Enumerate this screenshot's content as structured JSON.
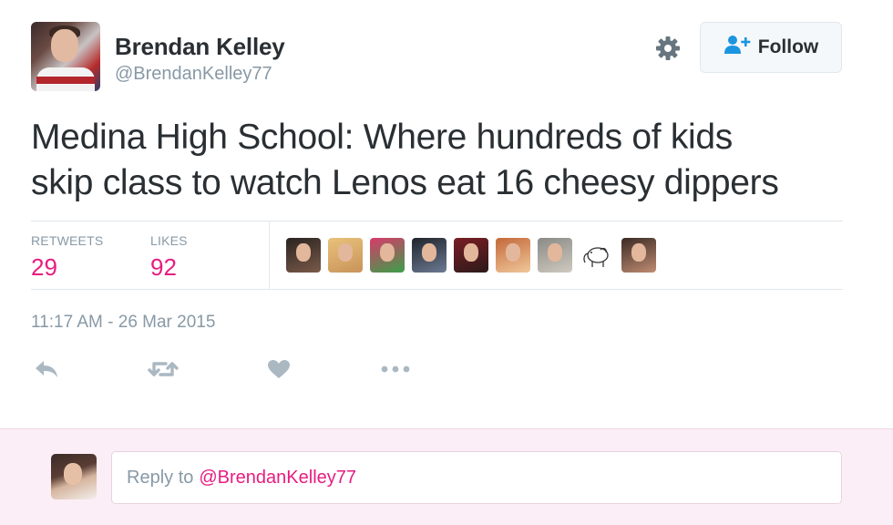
{
  "author": {
    "name": "Brendan Kelley",
    "handle": "@BrendanKelley77"
  },
  "follow_button": {
    "label": "Follow",
    "icon": "add-user-icon"
  },
  "settings_icon": "gear-icon",
  "tweet": {
    "line1": "Medina High School: Where hundreds of kids",
    "line2": "skip class to watch Lenos eat 16 cheesy dippers"
  },
  "stats": {
    "retweets_label": "RETWEETS",
    "retweets_value": "29",
    "likes_label": "LIKES",
    "likes_value": "92"
  },
  "likers": [
    {
      "name": "liker-avatar-1",
      "colors": [
        "#2a2320",
        "#7a5a4a"
      ]
    },
    {
      "name": "liker-avatar-2",
      "colors": [
        "#e8c27a",
        "#c9935a"
      ]
    },
    {
      "name": "liker-avatar-3",
      "colors": [
        "#d93a6a",
        "#3aa04a"
      ]
    },
    {
      "name": "liker-avatar-4",
      "colors": [
        "#20242c",
        "#6c7a92"
      ]
    },
    {
      "name": "liker-avatar-5",
      "colors": [
        "#7a1e24",
        "#2c1a1a"
      ]
    },
    {
      "name": "liker-avatar-6",
      "colors": [
        "#c4683a",
        "#f0c89a"
      ]
    },
    {
      "name": "liker-avatar-7",
      "colors": [
        "#8a8a86",
        "#cfcac0"
      ]
    },
    {
      "name": "liker-avatar-8",
      "colors": [
        "#ffffff",
        "#ffffff"
      ],
      "icon": "elephant-icon"
    },
    {
      "name": "liker-avatar-9",
      "colors": [
        "#3a2a24",
        "#c08c72"
      ]
    }
  ],
  "timestamp": "11:17 AM - 26 Mar 2015",
  "actions": [
    "reply-icon",
    "retweet-icon",
    "like-icon",
    "more-icon"
  ],
  "reply": {
    "prefix": "Reply to",
    "mention": "@BrendanKelley77"
  },
  "colors": {
    "accent": "#e81c80",
    "muted": "#8899a6",
    "text": "#292f33",
    "reply_bg": "#fbeef6"
  }
}
